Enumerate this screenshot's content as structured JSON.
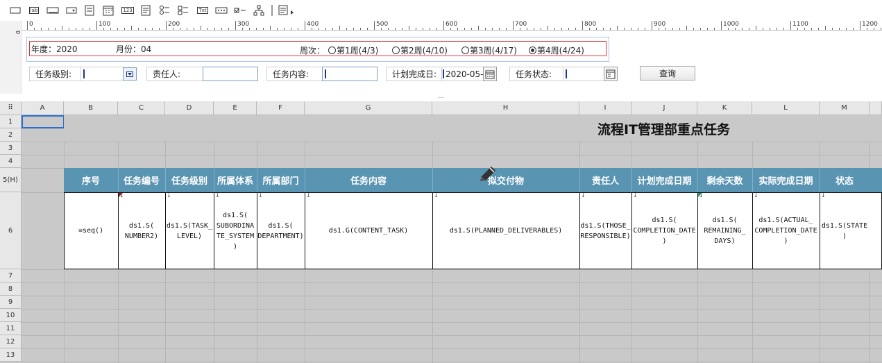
{
  "toolbar": {
    "icons": [
      "textbox-icon",
      "label-icon",
      "button-icon",
      "dropdown-icon",
      "listbox-icon",
      "calendar-icon",
      "number-icon",
      "multiline-icon",
      "radio-group-icon",
      "checkbox-group-icon",
      "text-icon",
      "password-icon",
      "checkbox-icon",
      "tree-icon",
      "report-icon"
    ],
    "label_text": "lab",
    "number_text": "123",
    "txt_text": "Txt"
  },
  "ruler": {
    "marks": [
      "0",
      "100",
      "200",
      "300",
      "400",
      "500",
      "600",
      "700",
      "800",
      "900",
      "1000",
      "1100",
      "1200"
    ],
    "v_mark": "0"
  },
  "params": {
    "year_label": "年度：2020",
    "month_label": "月份：04",
    "week_label": "周次：",
    "weeks": [
      "第1周(4/3)",
      "第2周(4/10)",
      "第3周(4/17)",
      "第4周(4/24)"
    ],
    "selected_week": 3,
    "task_level_label": "任务级别:",
    "owner_label": "责任人:",
    "content_label": "任务内容:",
    "plan_date_label": "计划完成日:",
    "plan_date_value": "2020-05-",
    "status_label": "任务状态:",
    "query_button": "查询"
  },
  "splitter": "...",
  "sheet": {
    "corner": "⠿",
    "columns": [
      "A",
      "B",
      "C",
      "D",
      "E",
      "F",
      "G",
      "H",
      "I",
      "J",
      "K",
      "L",
      "M"
    ],
    "rows": [
      "1",
      "2",
      "3",
      "4",
      "5(H)",
      "6",
      "7",
      "8",
      "9",
      "10",
      "11",
      "12",
      "13"
    ],
    "title": "流程IT管理部重点任务",
    "headers": [
      "序号",
      "任务编号",
      "任务级别",
      "所属体系",
      "所属部门",
      "任务内容",
      "拟交付物",
      "责任人",
      "计划完成日期",
      "剩余天数",
      "实际完成日期",
      "状态"
    ],
    "cells": [
      "=seq()",
      "ds1.S(\nNUMBER2)",
      "ds1.S(TASK_\nLEVEL)",
      "ds1.S(\nSUBORDINA\nTE_SYSTEM\n)",
      "ds1.S(\nDEPARTMENT)",
      "ds1.G(CONTENT_TASK)",
      "ds1.S(PLANNED_DELIVERABLES)",
      "ds1.S(THOSE_\nRESPONSIBLE)",
      "ds1.S(\nCOMPLETION_DATE\n)",
      "ds1.S(\nREMAINING_\nDAYS)",
      "ds1.S(ACTUAL_\nCOMPLETION_DATE\n)",
      "ds1.S(STATE\n)"
    ],
    "edit_icon": "pencil-icon"
  },
  "colors": {
    "header_band": "#5a94b3",
    "grid_bg": "#c9c9c9",
    "red_box": "#e03535"
  }
}
